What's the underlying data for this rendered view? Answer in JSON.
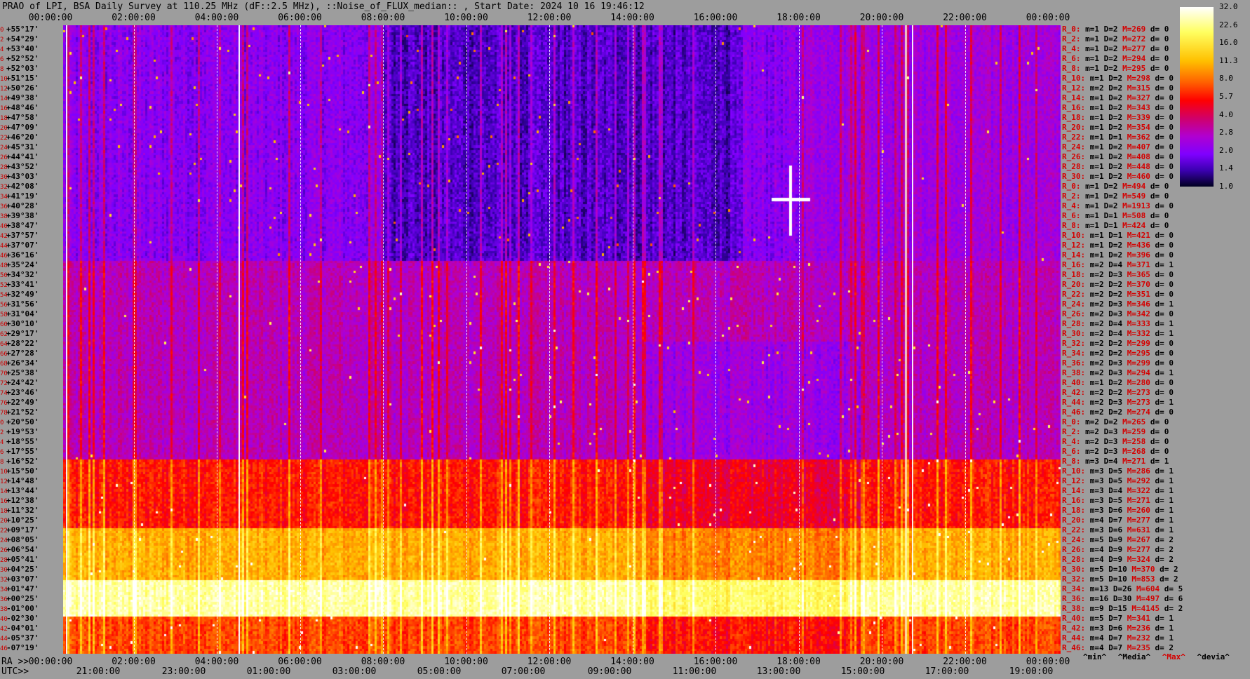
{
  "title": "PRAO of LPI, BSA Daily Survey at 110.25 MHz (dF::2.5 MHz), ::Noise_of_FLUX_median:: , Start Date: 2024 10 16 19:46:12",
  "top_times": [
    "00:00:00",
    "02:00:00",
    "04:00:00",
    "06:00:00",
    "08:00:00",
    "10:00:00",
    "12:00:00",
    "14:00:00",
    "16:00:00",
    "18:00:00",
    "20:00:00",
    "22:00:00",
    "00:00:00"
  ],
  "ra_label": "RA >>",
  "utc_label": "UTC>>",
  "ra_times": [
    "00:00:00",
    "02:00:00",
    "04:00:00",
    "06:00:00",
    "08:00:00",
    "10:00:00",
    "12:00:00",
    "14:00:00",
    "16:00:00",
    "18:00:00",
    "20:00:00",
    "22:00:00",
    "00:00:00"
  ],
  "utc_times": [
    "21:00:00",
    "23:00:00",
    "01:00:00",
    "03:00:00",
    "05:00:00",
    "07:00:00",
    "09:00:00",
    "11:00:00",
    "13:00:00",
    "15:00:00",
    "17:00:00",
    "19:00:00"
  ],
  "rows": [
    {
      "i": "0",
      "dec": "+55°17'",
      "r": "R_0:",
      "m": "1",
      "D": "2",
      "M": "269",
      "d": "0"
    },
    {
      "i": "2",
      "dec": "+54°29'",
      "r": "R_2:",
      "m": "1",
      "D": "2",
      "M": "272",
      "d": "0"
    },
    {
      "i": "4",
      "dec": "+53°40'",
      "r": "R_4:",
      "m": "1",
      "D": "2",
      "M": "277",
      "d": "0"
    },
    {
      "i": "6",
      "dec": "+52°52'",
      "r": "R_6:",
      "m": "1",
      "D": "2",
      "M": "294",
      "d": "0"
    },
    {
      "i": "8",
      "dec": "+52°03'",
      "r": "R_8:",
      "m": "1",
      "D": "2",
      "M": "295",
      "d": "0"
    },
    {
      "i": "10",
      "dec": "+51°15'",
      "r": "R_10:",
      "m": "1",
      "D": "2",
      "M": "298",
      "d": "0"
    },
    {
      "i": "12",
      "dec": "+50°26'",
      "r": "R_12:",
      "m": "2",
      "D": "2",
      "M": "315",
      "d": "0"
    },
    {
      "i": "14",
      "dec": "+49°38'",
      "r": "R_14:",
      "m": "1",
      "D": "2",
      "M": "327",
      "d": "0"
    },
    {
      "i": "16",
      "dec": "+48°46'",
      "r": "R_16:",
      "m": "1",
      "D": "2",
      "M": "343",
      "d": "0"
    },
    {
      "i": "18",
      "dec": "+47°58'",
      "r": "R_18:",
      "m": "1",
      "D": "2",
      "M": "339",
      "d": "0"
    },
    {
      "i": "20",
      "dec": "+47°09'",
      "r": "R_20:",
      "m": "1",
      "D": "2",
      "M": "354",
      "d": "0"
    },
    {
      "i": "22",
      "dec": "+46°20'",
      "r": "R_22:",
      "m": "1",
      "D": "1",
      "M": "362",
      "d": "0"
    },
    {
      "i": "24",
      "dec": "+45°31'",
      "r": "R_24:",
      "m": "1",
      "D": "2",
      "M": "407",
      "d": "0"
    },
    {
      "i": "26",
      "dec": "+44°41'",
      "r": "R_26:",
      "m": "1",
      "D": "2",
      "M": "408",
      "d": "0"
    },
    {
      "i": "28",
      "dec": "+43°52'",
      "r": "R_28:",
      "m": "1",
      "D": "2",
      "M": "448",
      "d": "0"
    },
    {
      "i": "30",
      "dec": "+43°03'",
      "r": "R_30:",
      "m": "1",
      "D": "2",
      "M": "460",
      "d": "0"
    },
    {
      "i": "32",
      "dec": "+42°08'",
      "r": "R_0:",
      "m": "1",
      "D": "2",
      "M": "494",
      "d": "0"
    },
    {
      "i": "34",
      "dec": "+41°19'",
      "r": "R_2:",
      "m": "1",
      "D": "2",
      "M": "549",
      "d": "0"
    },
    {
      "i": "36",
      "dec": "+40°28'",
      "r": "R_4:",
      "m": "1",
      "D": "2",
      "M": "1913",
      "d": "0"
    },
    {
      "i": "38",
      "dec": "+39°38'",
      "r": "R_6:",
      "m": "1",
      "D": "1",
      "M": "508",
      "d": "0"
    },
    {
      "i": "40",
      "dec": "+38°47'",
      "r": "R_8:",
      "m": "1",
      "D": "1",
      "M": "424",
      "d": "0"
    },
    {
      "i": "42",
      "dec": "+37°57'",
      "r": "R_10:",
      "m": "1",
      "D": "1",
      "M": "421",
      "d": "0"
    },
    {
      "i": "44",
      "dec": "+37°07'",
      "r": "R_12:",
      "m": "1",
      "D": "2",
      "M": "436",
      "d": "0"
    },
    {
      "i": "46",
      "dec": "+36°16'",
      "r": "R_14:",
      "m": "1",
      "D": "2",
      "M": "396",
      "d": "0"
    },
    {
      "i": "48",
      "dec": "+35°24'",
      "r": "R_16:",
      "m": "2",
      "D": "4",
      "M": "371",
      "d": "1"
    },
    {
      "i": "50",
      "dec": "+34°32'",
      "r": "R_18:",
      "m": "2",
      "D": "3",
      "M": "365",
      "d": "0"
    },
    {
      "i": "52",
      "dec": "+33°41'",
      "r": "R_20:",
      "m": "2",
      "D": "2",
      "M": "370",
      "d": "0"
    },
    {
      "i": "54",
      "dec": "+32°49'",
      "r": "R_22:",
      "m": "2",
      "D": "2",
      "M": "351",
      "d": "0"
    },
    {
      "i": "56",
      "dec": "+31°56'",
      "r": "R_24:",
      "m": "2",
      "D": "3",
      "M": "346",
      "d": "1"
    },
    {
      "i": "58",
      "dec": "+31°04'",
      "r": "R_26:",
      "m": "2",
      "D": "3",
      "M": "342",
      "d": "0"
    },
    {
      "i": "60",
      "dec": "+30°10'",
      "r": "R_28:",
      "m": "2",
      "D": "4",
      "M": "333",
      "d": "1"
    },
    {
      "i": "62",
      "dec": "+29°17'",
      "r": "R_30:",
      "m": "2",
      "D": "4",
      "M": "332",
      "d": "1"
    },
    {
      "i": "64",
      "dec": "+28°22'",
      "r": "R_32:",
      "m": "2",
      "D": "2",
      "M": "299",
      "d": "0"
    },
    {
      "i": "66",
      "dec": "+27°28'",
      "r": "R_34:",
      "m": "2",
      "D": "2",
      "M": "295",
      "d": "0"
    },
    {
      "i": "68",
      "dec": "+26°34'",
      "r": "R_36:",
      "m": "2",
      "D": "3",
      "M": "299",
      "d": "0"
    },
    {
      "i": "70",
      "dec": "+25°38'",
      "r": "R_38:",
      "m": "2",
      "D": "3",
      "M": "294",
      "d": "1"
    },
    {
      "i": "72",
      "dec": "+24°42'",
      "r": "R_40:",
      "m": "1",
      "D": "2",
      "M": "280",
      "d": "0"
    },
    {
      "i": "74",
      "dec": "+23°46'",
      "r": "R_42:",
      "m": "2",
      "D": "2",
      "M": "273",
      "d": "0"
    },
    {
      "i": "76",
      "dec": "+22°49'",
      "r": "R_44:",
      "m": "2",
      "D": "3",
      "M": "273",
      "d": "1"
    },
    {
      "i": "78",
      "dec": "+21°52'",
      "r": "R_46:",
      "m": "2",
      "D": "2",
      "M": "274",
      "d": "0"
    },
    {
      "i": "0",
      "dec": "+20°50'",
      "r": "R_0:",
      "m": "2",
      "D": "2",
      "M": "265",
      "d": "0"
    },
    {
      "i": "2",
      "dec": "+19°53'",
      "r": "R_2:",
      "m": "2",
      "D": "3",
      "M": "259",
      "d": "0"
    },
    {
      "i": "4",
      "dec": "+18°55'",
      "r": "R_4:",
      "m": "2",
      "D": "3",
      "M": "258",
      "d": "0"
    },
    {
      "i": "6",
      "dec": "+17°55'",
      "r": "R_6:",
      "m": "2",
      "D": "3",
      "M": "268",
      "d": "0"
    },
    {
      "i": "8",
      "dec": "+16°52'",
      "r": "R_8:",
      "m": "3",
      "D": "4",
      "M": "271",
      "d": "1"
    },
    {
      "i": "10",
      "dec": "+15°50'",
      "r": "R_10:",
      "m": "3",
      "D": "5",
      "M": "286",
      "d": "1"
    },
    {
      "i": "12",
      "dec": "+14°48'",
      "r": "R_12:",
      "m": "3",
      "D": "5",
      "M": "292",
      "d": "1"
    },
    {
      "i": "14",
      "dec": "+13°44'",
      "r": "R_14:",
      "m": "3",
      "D": "4",
      "M": "322",
      "d": "1"
    },
    {
      "i": "16",
      "dec": "+12°38'",
      "r": "R_16:",
      "m": "3",
      "D": "5",
      "M": "271",
      "d": "1"
    },
    {
      "i": "18",
      "dec": "+11°32'",
      "r": "R_18:",
      "m": "3",
      "D": "6",
      "M": "260",
      "d": "1"
    },
    {
      "i": "20",
      "dec": "+10°25'",
      "r": "R_20:",
      "m": "4",
      "D": "7",
      "M": "277",
      "d": "1"
    },
    {
      "i": "22",
      "dec": "+09°17'",
      "r": "R_22:",
      "m": "3",
      "D": "6",
      "M": "631",
      "d": "1"
    },
    {
      "i": "24",
      "dec": "+08°05'",
      "r": "R_24:",
      "m": "5",
      "D": "9",
      "M": "267",
      "d": "2"
    },
    {
      "i": "26",
      "dec": "+06°54'",
      "r": "R_26:",
      "m": "4",
      "D": "9",
      "M": "277",
      "d": "2"
    },
    {
      "i": "28",
      "dec": "+05°41'",
      "r": "R_28:",
      "m": "4",
      "D": "9",
      "M": "324",
      "d": "2"
    },
    {
      "i": "30",
      "dec": "+04°25'",
      "r": "R_30:",
      "m": "5",
      "D": "10",
      "M": "370",
      "d": "2"
    },
    {
      "i": "32",
      "dec": "+03°07'",
      "r": "R_32:",
      "m": "5",
      "D": "10",
      "M": "853",
      "d": "2"
    },
    {
      "i": "34",
      "dec": "+01°47'",
      "r": "R_34:",
      "m": "13",
      "D": "26",
      "M": "604",
      "d": "5"
    },
    {
      "i": "36",
      "dec": "+00°25'",
      "r": "R_36:",
      "m": "16",
      "D": "30",
      "M": "497",
      "d": "6"
    },
    {
      "i": "38",
      "dec": "-01°00'",
      "r": "R_38:",
      "m": "9",
      "D": "15",
      "M": "4145",
      "d": "2"
    },
    {
      "i": "40",
      "dec": "-02°30'",
      "r": "R_40:",
      "m": "5",
      "D": "7",
      "M": "341",
      "d": "1"
    },
    {
      "i": "42",
      "dec": "-04°01'",
      "r": "R_42:",
      "m": "3",
      "D": "6",
      "M": "236",
      "d": "1"
    },
    {
      "i": "44",
      "dec": "-05°37'",
      "r": "R_44:",
      "m": "4",
      "D": "7",
      "M": "232",
      "d": "1"
    },
    {
      "i": "46",
      "dec": "-07°19'",
      "r": "R_46:",
      "m": "4",
      "D": "7",
      "M": "235",
      "d": "2"
    }
  ],
  "legend": {
    "min": "^min^",
    "media": "^Media^",
    "max": "^Max^",
    "devia": "^devia^"
  },
  "colorbar_ticks": [
    "32.0",
    "22.6",
    "16.0",
    "11.3",
    "8.0",
    "5.7",
    "4.0",
    "2.8",
    "2.0",
    "1.4",
    "1.0"
  ],
  "colors": {
    "background": "#9d9d9d",
    "label_red": "#d40000",
    "text": "#000000"
  }
}
